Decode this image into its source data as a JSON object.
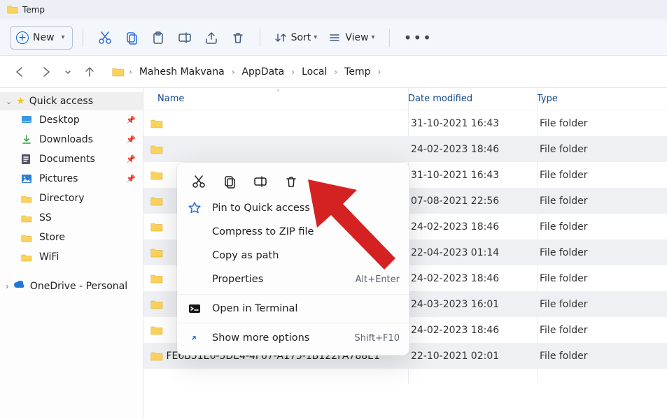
{
  "window": {
    "title": "Temp"
  },
  "ribbon": {
    "new": "New",
    "sort": "Sort",
    "view": "View"
  },
  "breadcrumb": [
    "Mahesh Makvana",
    "AppData",
    "Local",
    "Temp"
  ],
  "sidebar": {
    "quick": "Quick access",
    "items": [
      {
        "label": "Desktop",
        "icon": "desktop"
      },
      {
        "label": "Downloads",
        "icon": "downloads"
      },
      {
        "label": "Documents",
        "icon": "documents"
      },
      {
        "label": "Pictures",
        "icon": "pictures"
      },
      {
        "label": "Directory",
        "icon": "folder"
      },
      {
        "label": "SS",
        "icon": "folder"
      },
      {
        "label": "Store",
        "icon": "folder"
      },
      {
        "label": "WiFi",
        "icon": "folder"
      }
    ],
    "onedrive": "OneDrive - Personal"
  },
  "columns": {
    "name": "Name",
    "date": "Date modified",
    "type": "Type"
  },
  "type_label": "File folder",
  "rows": [
    {
      "name": "",
      "date": "31-10-2021 16:43"
    },
    {
      "name": "",
      "date": "24-02-2023 18:46"
    },
    {
      "name": "",
      "date": "31-10-2021 16:43"
    },
    {
      "name": "",
      "date": "07-08-2021 22:56"
    },
    {
      "name": "",
      "date": "24-02-2023 18:46"
    },
    {
      "name": "",
      "date": "22-04-2023 01:14"
    },
    {
      "name": "",
      "date": "24-02-2023 18:46"
    },
    {
      "name": "",
      "date": "24-03-2023 16:01"
    },
    {
      "name": "",
      "date": "24-02-2023 18:46"
    },
    {
      "name": "FE6B51E6-5DE4-4F67-A173-1B122FA788E1",
      "date": "22-10-2021 02:01"
    }
  ],
  "context": {
    "pin": "Pin to Quick access",
    "zip": "Compress to ZIP file",
    "copypath": "Copy as path",
    "props": "Properties",
    "props_short": "Alt+Enter",
    "terminal": "Open in Terminal",
    "more": "Show more options",
    "more_short": "Shift+F10"
  }
}
